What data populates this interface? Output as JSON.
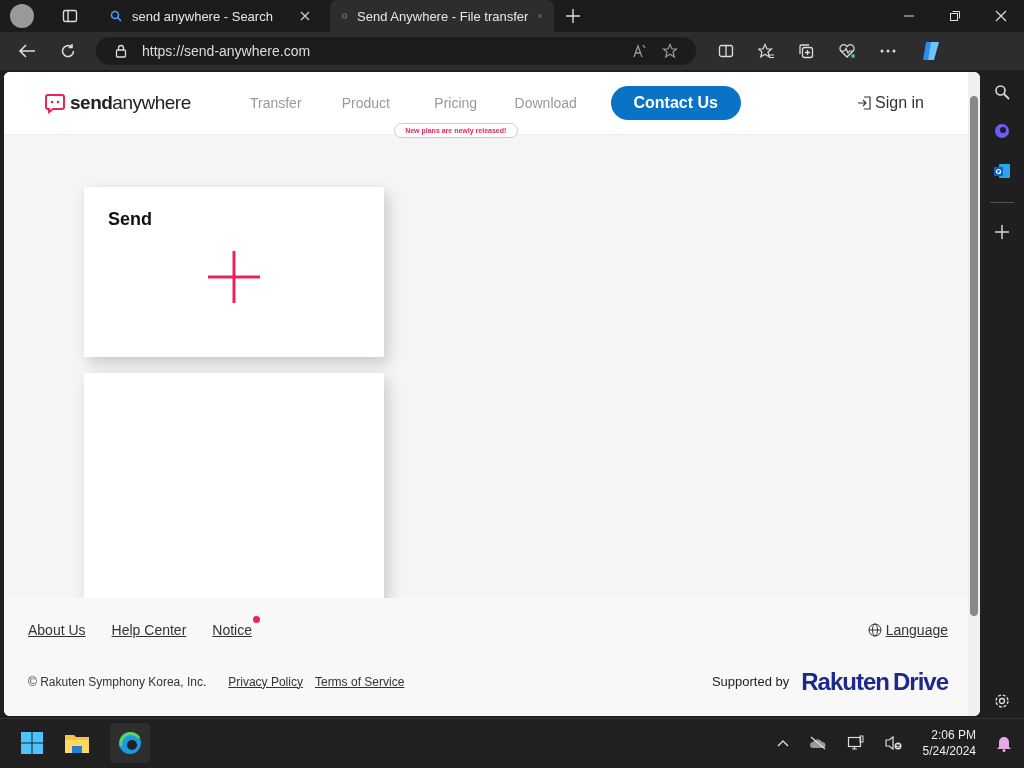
{
  "browser": {
    "tabs": [
      {
        "title": "send anywhere - Search",
        "selected": false,
        "kind": "search"
      },
      {
        "title": "Send Anywhere - File transfer",
        "selected": true,
        "kind": "site"
      }
    ],
    "address": {
      "url": "https://send-anywhere.com"
    }
  },
  "site": {
    "logo": "**send**anywhere",
    "nav": [
      {
        "label": "Transfer"
      },
      {
        "label": "Product"
      },
      {
        "label": "Pricing"
      },
      {
        "label": "Download"
      }
    ],
    "tooltip": "New plans are newly released!",
    "contact": "Contact Us",
    "sign_in": "Sign in"
  },
  "send_card": {
    "title": "Send"
  },
  "footer": {
    "links": [
      {
        "label": "About Us",
        "badge": false
      },
      {
        "label": "Help Center",
        "badge": false
      },
      {
        "label": "Notice",
        "badge": true
      }
    ],
    "language": "Language",
    "copyright": "© Rakuten Symphony Korea, Inc.",
    "legal": [
      {
        "label": "Privacy Policy"
      },
      {
        "label": "Terms of Service"
      }
    ],
    "supported_by": "Supported by",
    "brand": "Rakuten",
    "brand_2": "Drive"
  },
  "taskbar": {
    "time": "2:06 PM",
    "date": "5/24/2024"
  }
}
